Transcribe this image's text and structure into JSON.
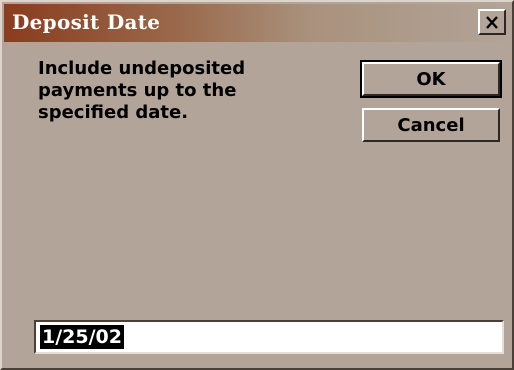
{
  "window": {
    "title": "Deposit Date",
    "close_icon": "close-x-icon"
  },
  "message": {
    "line1": "Include undeposited",
    "line2": "payments up to the",
    "line3": "specified date."
  },
  "buttons": {
    "ok_label": "OK",
    "cancel_label": "Cancel"
  },
  "date_field": {
    "value": "1/25/02"
  },
  "colors": {
    "dialog_face": "#b2a498",
    "title_gradient_start": "#8a3c1e",
    "selection": "#000000"
  }
}
